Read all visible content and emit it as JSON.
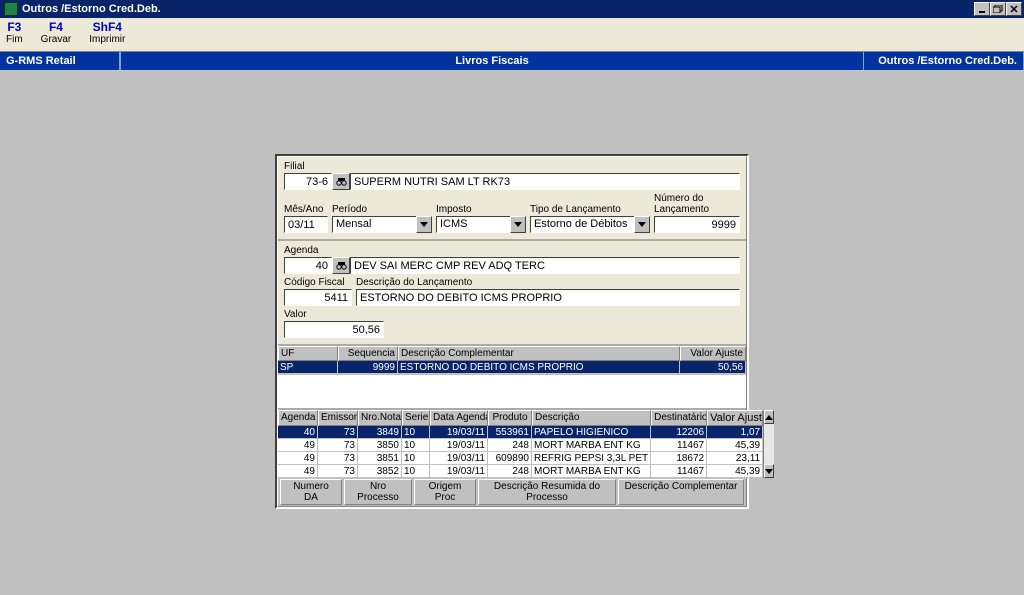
{
  "window": {
    "title": "Outros /Estorno Cred.Deb."
  },
  "menubar": {
    "items": [
      {
        "key": "F3",
        "label": "Fim"
      },
      {
        "key": "F4",
        "label": "Gravar"
      },
      {
        "key": "ShF4",
        "label": "Imprimir"
      }
    ]
  },
  "bluebar": {
    "left": "G-RMS Retail",
    "center": "Livros Fiscais",
    "right": "Outros /Estorno Cred.Deb."
  },
  "filial": {
    "label": "Filial",
    "codigo": "73-6",
    "desc": "SUPERM NUTRI SAM LT RK73"
  },
  "periodo_row": {
    "mesano_label": "Mês/Ano",
    "mesano_value": "03/11",
    "periodo_label": "Período",
    "periodo_value": "Mensal",
    "imposto_label": "Imposto",
    "imposto_value": "ICMS",
    "tipo_label": "Tipo de Lançamento",
    "tipo_value": "Estorno de Débitos",
    "numero_label": "Número do Lançamento",
    "numero_value": "9999"
  },
  "agenda": {
    "label": "Agenda",
    "codigo": "40",
    "desc": "DEV SAI MERC CMP REV ADQ TERC",
    "codigo_fiscal_label": "Código Fiscal",
    "codigo_fiscal_value": "5411",
    "descricao_lanc_label": "Descrição do Lançamento",
    "descricao_lanc_value": "ESTORNO DO DEBITO ICMS PROPRIO",
    "valor_label": "Valor",
    "valor_value": "50,56"
  },
  "grid1": {
    "headers": {
      "uf": "UF",
      "seq": "Sequencia",
      "desc": "Descrição Complementar",
      "val": "Valor Ajuste"
    },
    "rows": [
      {
        "uf": "SP",
        "seq": "9999",
        "desc": "ESTORNO DO DEBITO ICMS PROPRIO",
        "val": "50,56",
        "sel": true
      }
    ]
  },
  "grid2": {
    "headers": {
      "agenda": "Agenda",
      "emissor": "Emissor",
      "nro": "Nro.Nota",
      "serie": "Serie",
      "data": "Data Agenda",
      "produto": "Produto",
      "desc": "Descrição",
      "dest": "Destinatário",
      "val": "Valor Ajuste"
    },
    "rows": [
      {
        "agenda": "40",
        "emissor": "73",
        "nro": "3849",
        "serie": "10",
        "data": "19/03/11",
        "produto": "553961",
        "desc": "PAPELO HIGIENICO",
        "dest": "12206",
        "val": "1,07",
        "sel": true
      },
      {
        "agenda": "49",
        "emissor": "73",
        "nro": "3850",
        "serie": "10",
        "data": "19/03/11",
        "produto": "248",
        "desc": "MORT MARBA ENT KG",
        "dest": "11467",
        "val": "45,39"
      },
      {
        "agenda": "49",
        "emissor": "73",
        "nro": "3851",
        "serie": "10",
        "data": "19/03/11",
        "produto": "609890",
        "desc": "REFRIG PEPSI 3,3L PET",
        "dest": "18672",
        "val": "23,11"
      },
      {
        "agenda": "49",
        "emissor": "73",
        "nro": "3852",
        "serie": "10",
        "data": "19/03/11",
        "produto": "248",
        "desc": "MORT MARBA ENT KG",
        "dest": "11467",
        "val": "45,39"
      }
    ]
  },
  "bottom_tabs": {
    "c1": "Numero DA",
    "c2": "Nro Processo",
    "c3": "Origem Proc",
    "c4": "Descrição Resumida do Processo",
    "c5": "Descrição Complementar"
  }
}
